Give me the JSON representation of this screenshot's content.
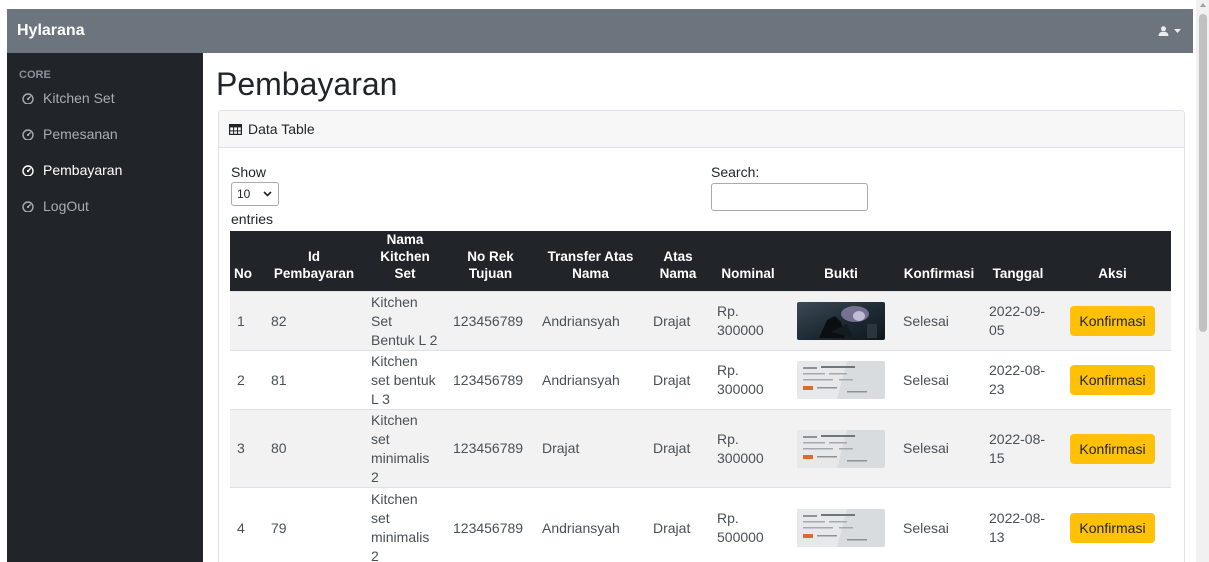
{
  "app": {
    "brand": "Hylarana"
  },
  "sidebar": {
    "heading": "CORE",
    "items": [
      {
        "label": "Kitchen Set"
      },
      {
        "label": "Pemesanan"
      },
      {
        "label": "Pembayaran"
      },
      {
        "label": "LogOut"
      }
    ],
    "active_item": "Pembayaran"
  },
  "page": {
    "title": "Pembayaran"
  },
  "card": {
    "header": "Data Table"
  },
  "length": {
    "show": "Show",
    "value": "10",
    "entries": "entries"
  },
  "search": {
    "label": "Search:",
    "value": ""
  },
  "table": {
    "headers": [
      "No",
      "Id Pembayaran",
      "Nama Kitchen Set",
      "No Rek Tujuan",
      "Transfer Atas Nama",
      "Atas Nama",
      "Nominal",
      "Bukti",
      "Konfirmasi",
      "Tanggal",
      "Aksi"
    ],
    "rows": [
      {
        "no": "1",
        "id": "82",
        "nama": "Kitchen Set Bentuk L 2",
        "rek": "123456789",
        "transfer": "Andriansyah",
        "atas": "Drajat",
        "nominal": "Rp. 300000",
        "bukti": "dark-fantasy-image",
        "konfirmasi": "Selesai",
        "tanggal": "2022-09-05",
        "aksi": "Konfirmasi"
      },
      {
        "no": "2",
        "id": "81",
        "nama": "Kitchen set bentuk L 3",
        "rek": "123456789",
        "transfer": "Andriansyah",
        "atas": "Drajat",
        "nominal": "Rp. 300000",
        "bukti": "transfer-receipt-image",
        "konfirmasi": "Selesai",
        "tanggal": "2022-08-23",
        "aksi": "Konfirmasi"
      },
      {
        "no": "3",
        "id": "80",
        "nama": "Kitchen set minimalis 2",
        "rek": "123456789",
        "transfer": "Drajat",
        "atas": "Drajat",
        "nominal": "Rp. 300000",
        "bukti": "transfer-receipt-image",
        "konfirmasi": "Selesai",
        "tanggal": "2022-08-15",
        "aksi": "Konfirmasi"
      },
      {
        "no": "4",
        "id": "79",
        "nama": "Kitchen set minimalis 2",
        "rek": "123456789",
        "transfer": "Andriansyah",
        "atas": "Drajat",
        "nominal": "Rp. 500000",
        "bukti": "transfer-receipt-image",
        "konfirmasi": "Selesai",
        "tanggal": "2022-08-13",
        "aksi": "Konfirmasi"
      }
    ]
  },
  "colors": {
    "topbar": "#6c757d",
    "sidebar": "#212529",
    "table_head": "#212529",
    "button": "#ffc107"
  },
  "icons": {
    "user": "user-icon",
    "nav": "tachometer-icon",
    "table": "table-icon"
  }
}
